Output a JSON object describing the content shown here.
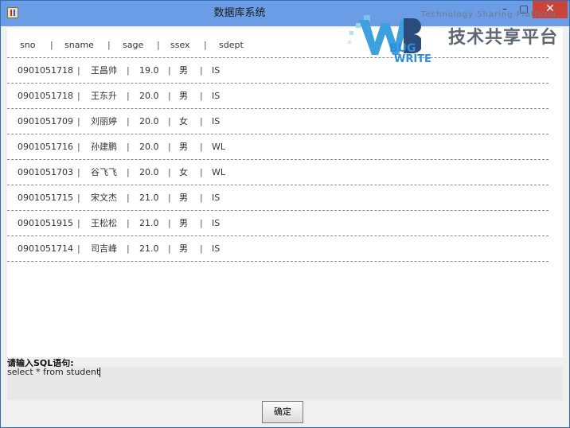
{
  "window": {
    "title": "数据库系统",
    "controls": {
      "minimize": "–",
      "maximize": "□",
      "close": "✕"
    }
  },
  "watermark": {
    "tagline": "Technology Sharing Platform",
    "brand_bug": "BUG",
    "brand_write": "WRITE",
    "brand_cn": "技术共享平台"
  },
  "table": {
    "separator": "|",
    "columns": [
      "sno",
      "sname",
      "sage",
      "ssex",
      "sdept"
    ],
    "rows": [
      [
        "0901051718",
        "王昌帅",
        "19.0",
        "男",
        "IS"
      ],
      [
        "0901051718",
        "王东升",
        "20.0",
        "男",
        "IS"
      ],
      [
        "0901051709",
        "刘丽婷",
        "20.0",
        "女",
        "IS"
      ],
      [
        "0901051716",
        "孙建鹏",
        "20.0",
        "男",
        "WL"
      ],
      [
        "0901051703",
        "谷飞飞",
        "20.0",
        "女",
        "WL"
      ],
      [
        "0901051715",
        "宋文杰",
        "21.0",
        "男",
        "IS"
      ],
      [
        "0901051915",
        "王松松",
        "21.0",
        "男",
        "IS"
      ],
      [
        "0901051714",
        "司吉峰",
        "21.0",
        "男",
        "IS"
      ]
    ]
  },
  "input": {
    "label": "请输入SQL语句:",
    "value": "select * from student"
  },
  "buttons": {
    "confirm": "确定"
  },
  "colors": {
    "titlebar": "#6a9de6",
    "close": "#c9453c",
    "accent": "#2e8fd6"
  }
}
